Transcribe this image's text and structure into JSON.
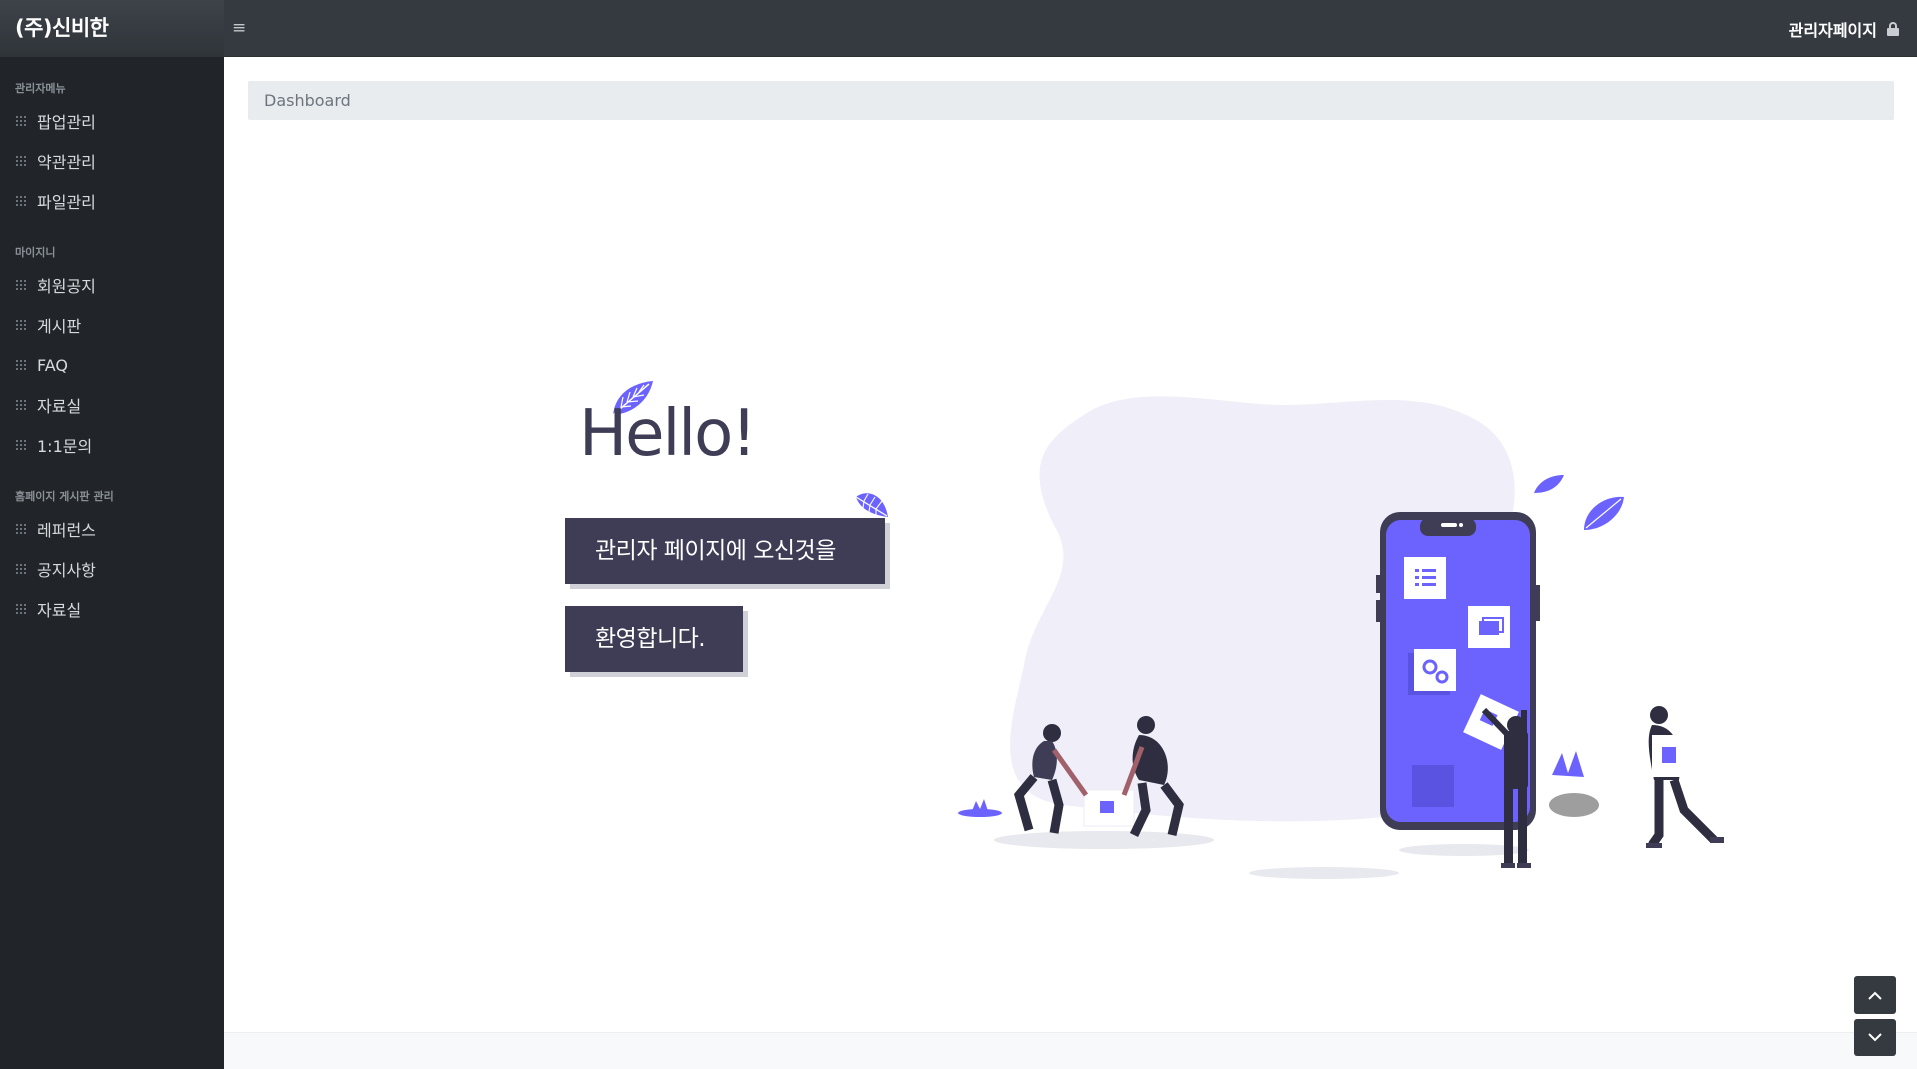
{
  "header": {
    "brand": "(주)신비한",
    "user_label": "관리자페이지",
    "menu_icon": "hamburger-icon",
    "lock_icon": "lock-icon"
  },
  "sidebar": {
    "sections": [
      {
        "heading": "관리자메뉴",
        "items": [
          {
            "label": "팝업관리"
          },
          {
            "label": "약관관리"
          },
          {
            "label": "파일관리"
          }
        ]
      },
      {
        "heading": "마이지니",
        "items": [
          {
            "label": "회원공지"
          },
          {
            "label": "게시판"
          },
          {
            "label": "FAQ"
          },
          {
            "label": "자료실"
          },
          {
            "label": "1:1문의"
          }
        ]
      },
      {
        "heading": "홈페이지 게시판 관리",
        "items": [
          {
            "label": "레퍼런스"
          },
          {
            "label": "공지사항"
          },
          {
            "label": "자료실"
          }
        ]
      }
    ]
  },
  "main": {
    "breadcrumb": "Dashboard",
    "hello": "Hello!",
    "welcome_line1": "관리자 페이지에 오신것을",
    "welcome_line2": "환영합니다."
  },
  "colors": {
    "topbar": "#343a40",
    "sidebar": "#212529",
    "accent": "#6c63ff",
    "dark_purple": "#3f3d56"
  }
}
